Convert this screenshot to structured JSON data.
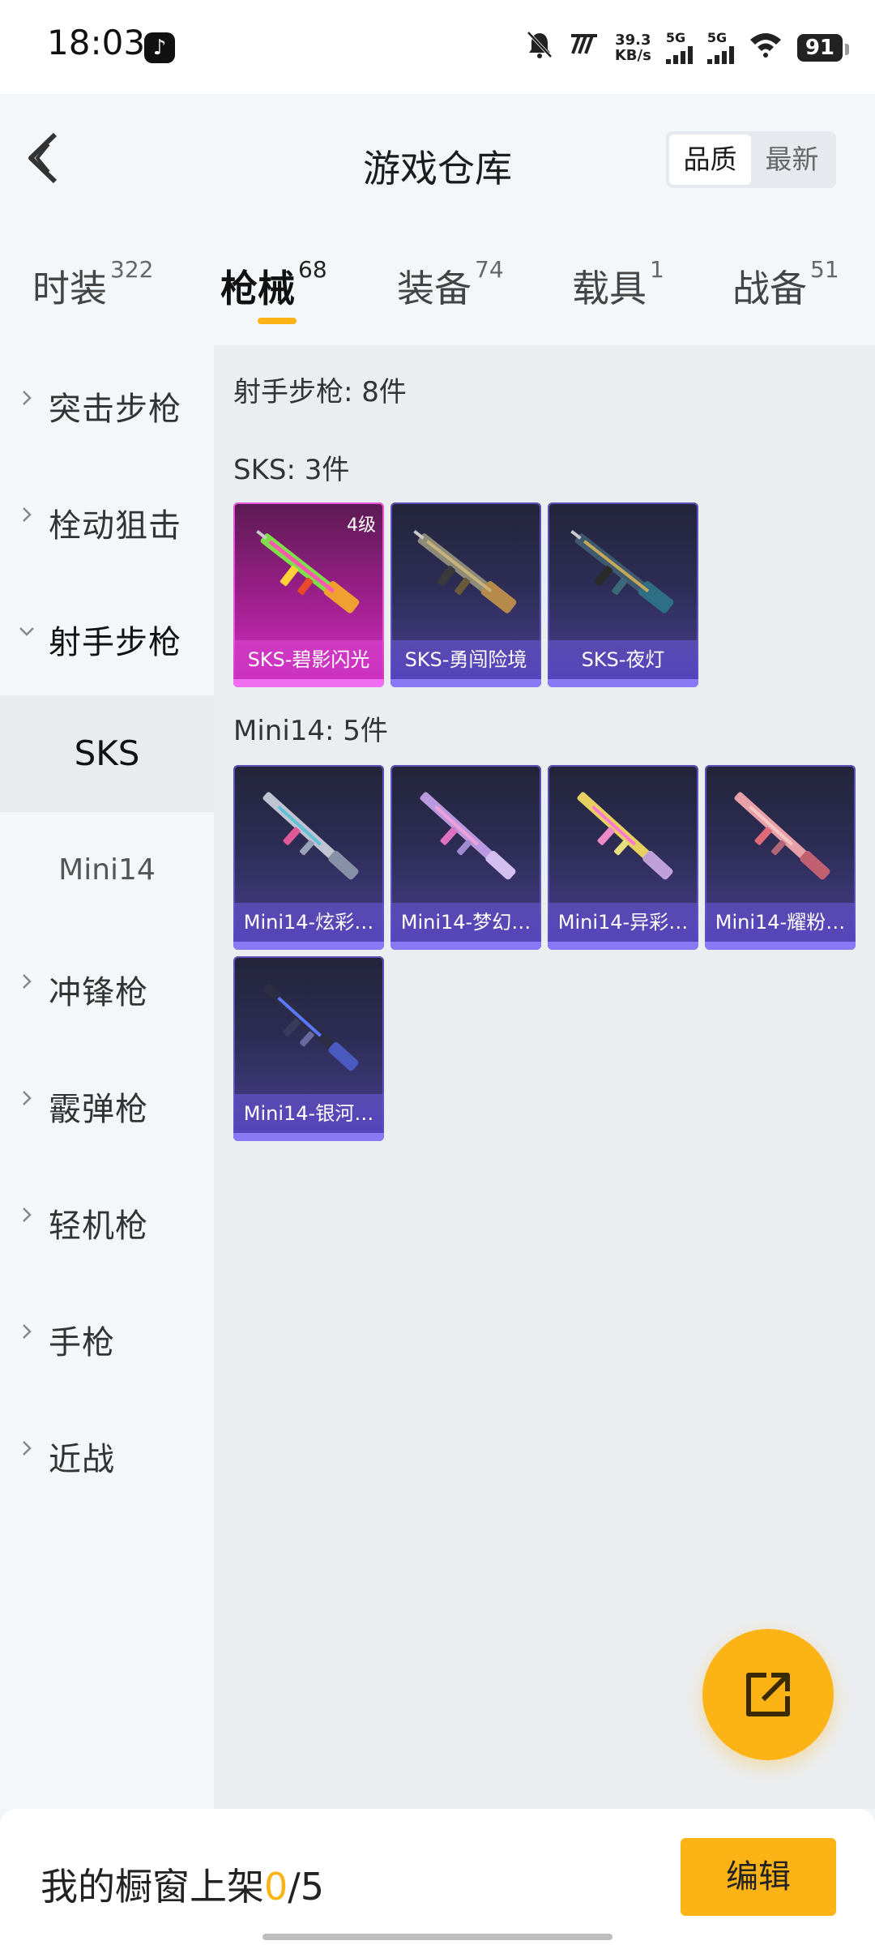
{
  "status_bar": {
    "time": "18:03",
    "net_speed_value": "39.3",
    "net_speed_unit": "KB/s",
    "sim1": "5G",
    "sim2": "5G",
    "battery": "91"
  },
  "header": {
    "title": "游戏仓库",
    "sort_options": [
      "品质",
      "最新"
    ],
    "active_sort": "品质"
  },
  "tabs": [
    {
      "label": "时装",
      "count": "322"
    },
    {
      "label": "枪械",
      "count": "68",
      "active": true
    },
    {
      "label": "装备",
      "count": "74"
    },
    {
      "label": "载具",
      "count": "1"
    },
    {
      "label": "战备",
      "count": "51"
    }
  ],
  "sidebar": {
    "items": [
      "突击步枪",
      "栓动狙击",
      "射手步枪",
      "冲锋枪",
      "霰弹枪",
      "轻机枪",
      "手枪",
      "近战"
    ],
    "open_item": "射手步枪",
    "subitems": [
      "SKS",
      "Mini14"
    ],
    "active_subitem": "SKS"
  },
  "content": {
    "category_summary": "射手步枪: 8件",
    "groups": [
      {
        "title": "SKS: 3件",
        "items": [
          {
            "name": "SKS-碧影闪光",
            "level": "4级",
            "rarity": "gold"
          },
          {
            "name": "SKS-勇闯险境",
            "rarity": "purple"
          },
          {
            "name": "SKS-夜灯",
            "rarity": "purple"
          }
        ]
      },
      {
        "title": "Mini14: 5件",
        "items": [
          {
            "name": "Mini14-炫彩…",
            "rarity": "purple"
          },
          {
            "name": "Mini14-梦幻…",
            "rarity": "purple"
          },
          {
            "name": "Mini14-异彩…",
            "rarity": "purple"
          },
          {
            "name": "Mini14-耀粉…",
            "rarity": "purple"
          },
          {
            "name": "Mini14-银河…",
            "rarity": "purple"
          }
        ]
      }
    ]
  },
  "bottom": {
    "label": "我的橱窗上架",
    "current": "0",
    "separator": "/",
    "max": "5",
    "edit_label": "编辑"
  },
  "colors": {
    "accent": "#fcb316",
    "gold_card": "#d630c9",
    "purple_card": "#4a3f95"
  }
}
